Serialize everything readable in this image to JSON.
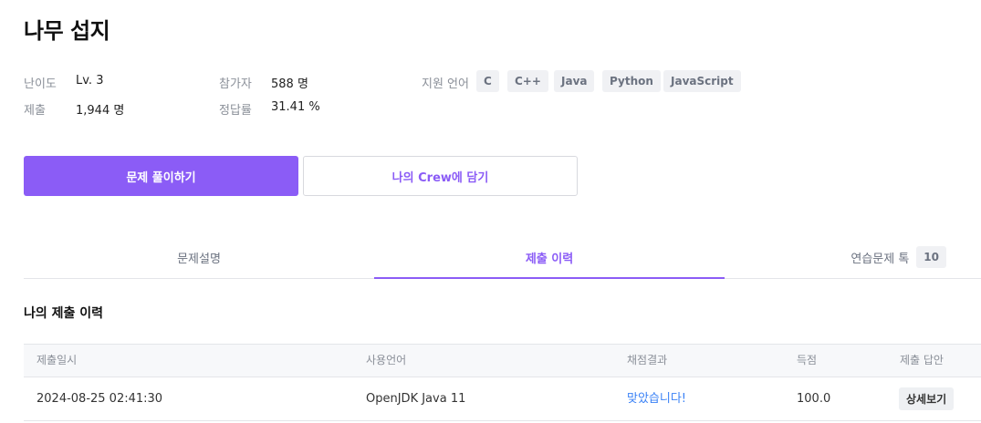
{
  "problem": {
    "title": "나무 섭지"
  },
  "meta": {
    "difficulty_label": "난이도",
    "difficulty_value": "Lv. 3",
    "submissions_label": "제출",
    "submissions_value": "1,944 명",
    "participants_label": "참가자",
    "participants_value": "588 명",
    "accuracy_label": "정답률",
    "accuracy_value": "31.41 %",
    "languages_label": "지원 언어",
    "languages": [
      "C",
      "C++",
      "Java",
      "Python",
      "JavaScript"
    ]
  },
  "actions": {
    "solve_label": "문제 풀이하기",
    "crew_label": "나의 Crew에 담기"
  },
  "tabs": [
    {
      "label": "문제설명",
      "active": false
    },
    {
      "label": "제출 이력",
      "active": true
    },
    {
      "label": "연습문제 톡",
      "count": "10",
      "active": false
    }
  ],
  "history": {
    "title": "나의 제출 이력",
    "columns": [
      "제출일시",
      "사용언어",
      "채점결과",
      "득점",
      "제출 답안"
    ],
    "rows": [
      {
        "datetime": "2024-08-25 02:41:30",
        "language": "OpenJDK Java 11",
        "result": "맞았습니다!",
        "score": "100.0",
        "action_label": "상세보기"
      }
    ]
  },
  "colors": {
    "accent": "#8b5cf6",
    "result_success": "#3b82f6"
  }
}
